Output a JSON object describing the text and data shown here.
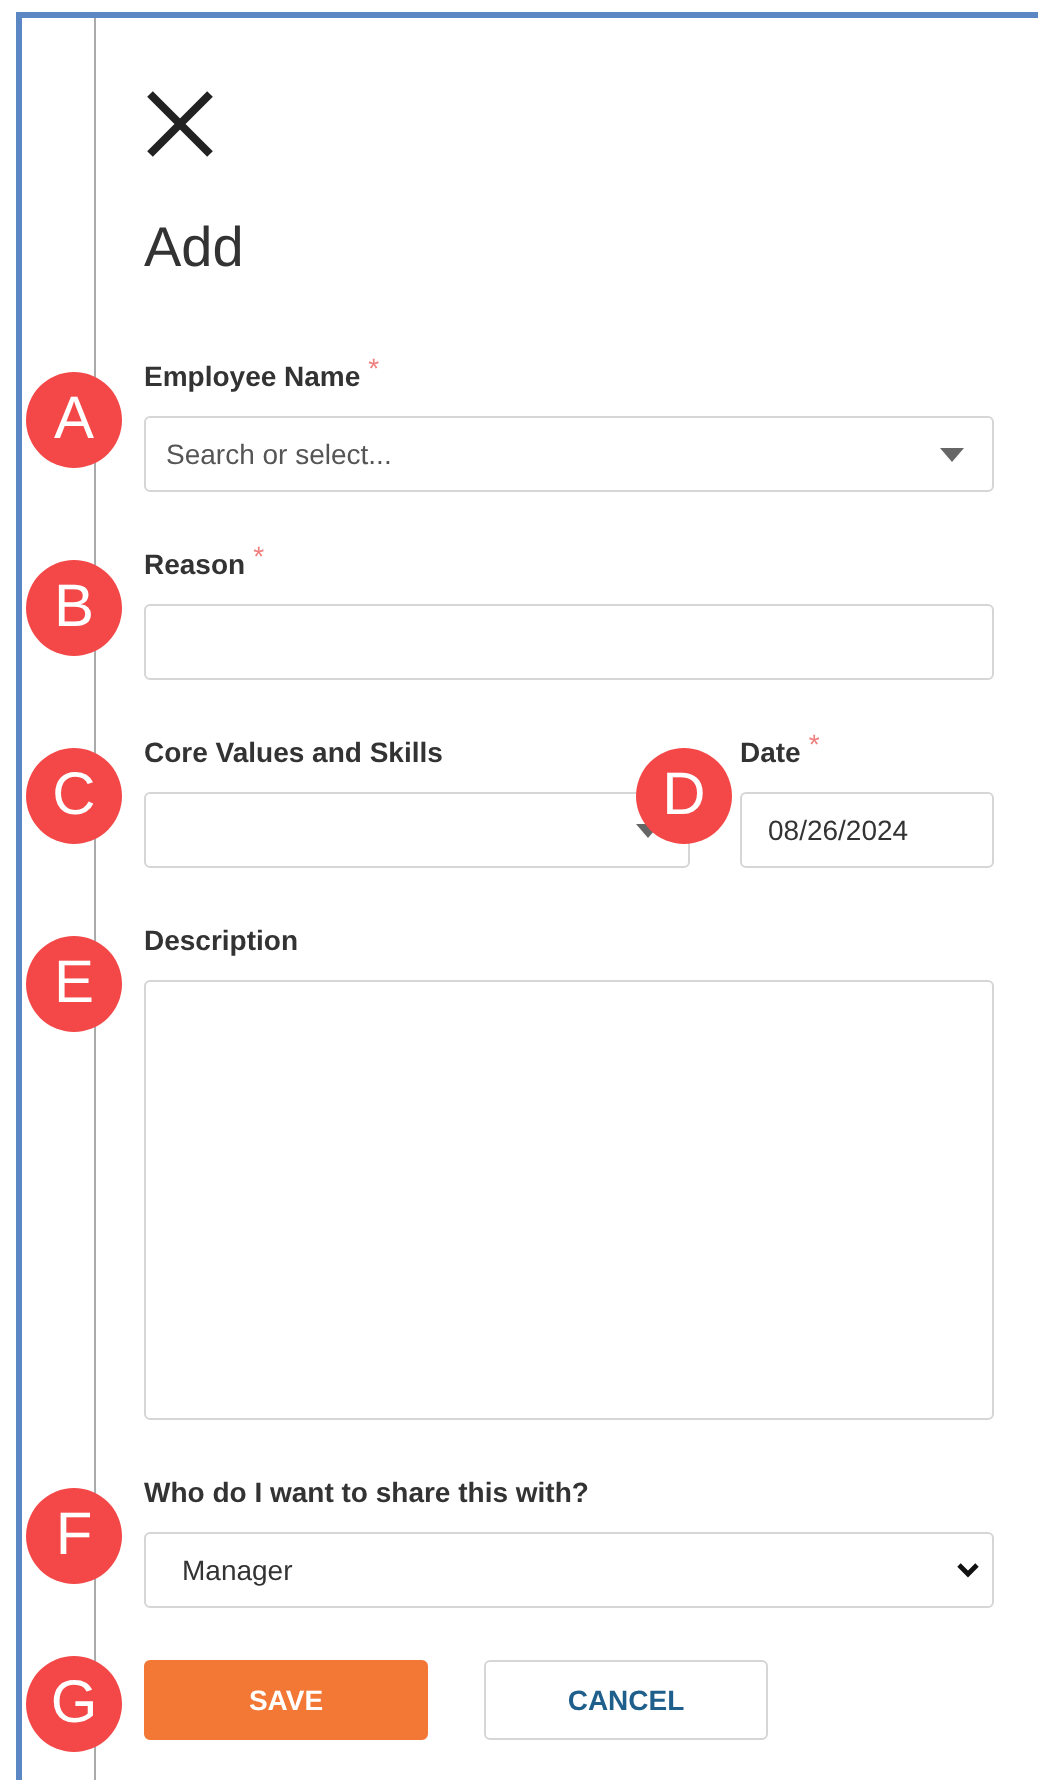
{
  "title": "Add",
  "rows": [
    [
      {
        "label": "Employee Name",
        "required_mark": "*",
        "kind": "combobox",
        "placeholder": "Search or select...",
        "marker": "A"
      }
    ],
    [
      {
        "label": "Reason",
        "required_mark": "*",
        "kind": "text",
        "marker": "B"
      }
    ],
    [
      {
        "label": "Core Values and Skills",
        "kind": "combobox",
        "marker": "C"
      },
      {
        "label": "Date",
        "required_mark": "*",
        "kind": "text",
        "value": "08/26/2024",
        "marker": "D"
      }
    ],
    [
      {
        "label": "Description",
        "kind": "textarea",
        "marker": "E"
      }
    ],
    [
      {
        "label": "Who do I want to share this with?",
        "kind": "select",
        "value": "Manager",
        "marker": "F"
      }
    ]
  ],
  "actions": {
    "marker": "G",
    "buttons": [
      {
        "label": "SAVE",
        "kind": "primary"
      },
      {
        "label": "CANCEL",
        "kind": "secondary"
      }
    ]
  }
}
